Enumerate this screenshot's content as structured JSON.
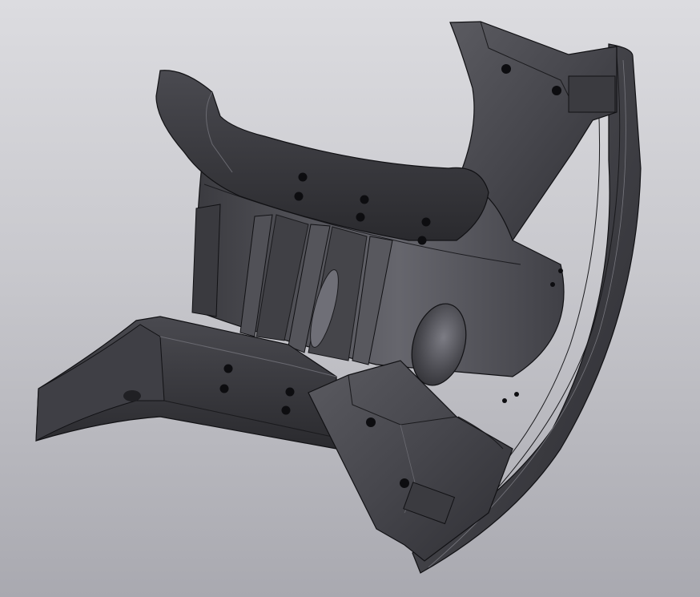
{
  "scene": {
    "background_top": "#dcdce0",
    "background_bottom": "#a9a9b0",
    "part_dark": "#2f2f33",
    "part_mid": "#4a4a50",
    "part_light": "#6e6e75",
    "edge": "#101012",
    "hole": "#0d0d10"
  }
}
